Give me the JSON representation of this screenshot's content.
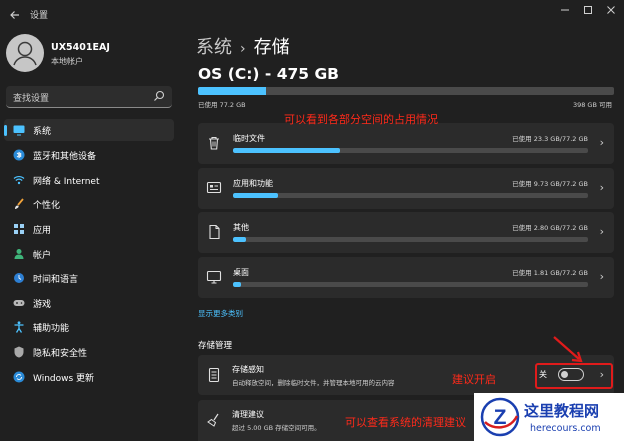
{
  "window": {
    "title": "设置",
    "back_icon": "arrow-left-icon",
    "controls": [
      "minimize-icon",
      "maximize-icon",
      "close-icon"
    ]
  },
  "user": {
    "name": "UX5401EAJ",
    "account_type": "本地帐户"
  },
  "search": {
    "placeholder": "查找设置"
  },
  "sidebar": {
    "items": [
      {
        "label": "系统",
        "icon": "monitor-icon",
        "active": true
      },
      {
        "label": "蓝牙和其他设备",
        "icon": "bluetooth-icon"
      },
      {
        "label": "网络 & Internet",
        "icon": "wifi-icon"
      },
      {
        "label": "个性化",
        "icon": "brush-icon"
      },
      {
        "label": "应用",
        "icon": "apps-icon"
      },
      {
        "label": "帐户",
        "icon": "person-icon"
      },
      {
        "label": "时间和语言",
        "icon": "globe-clock-icon"
      },
      {
        "label": "游戏",
        "icon": "gamepad-icon"
      },
      {
        "label": "辅助功能",
        "icon": "accessibility-icon"
      },
      {
        "label": "隐私和安全性",
        "icon": "shield-icon"
      },
      {
        "label": "Windows 更新",
        "icon": "windows-update-icon"
      }
    ]
  },
  "breadcrumb": {
    "parent": "系统",
    "separator": "›",
    "current": "存储"
  },
  "drive": {
    "title": "OS (C:) - 475 GB",
    "used_label": "已使用 77.2 GB",
    "total_label": "398 GB 可用",
    "used_fraction": 0.1625
  },
  "categories": [
    {
      "name": "临时文件",
      "used": "已使用 23.3 GB/77.2 GB",
      "fraction": 0.302,
      "icon": "trash-icon"
    },
    {
      "name": "应用和功能",
      "used": "已使用 9.73 GB/77.2 GB",
      "fraction": 0.126,
      "icon": "apps-features-icon"
    },
    {
      "name": "其他",
      "used": "已使用 2.80 GB/77.2 GB",
      "fraction": 0.036,
      "icon": "document-icon"
    },
    {
      "name": "桌面",
      "used": "已使用 1.81 GB/77.2 GB",
      "fraction": 0.023,
      "icon": "desktop-icon"
    }
  ],
  "more_categories": "显示更多类别",
  "storage_management": {
    "title": "存储管理",
    "sense": {
      "name": "存储感知",
      "desc": "自动释放空间，删除临时文件，并管理本地可用的云内容",
      "state": "关",
      "icon": "storage-drive-icon"
    },
    "cleanup": {
      "name": "清理建议",
      "desc": "超过 5.00 GB 存储空间可用。",
      "icon": "broom-icon"
    }
  },
  "annotations": {
    "top": "可以看到各部分空间的占用情况",
    "enable": "建议开启",
    "cleanup": "可以查看系统的清理建议"
  },
  "watermark": {
    "logo": "Z",
    "text": "这里教程网",
    "url": "herecours.com"
  },
  "colors": {
    "accent": "#4cc2ff",
    "background": "#202020",
    "card": "#2b2b2b",
    "annotation": "#ff2a1a"
  }
}
